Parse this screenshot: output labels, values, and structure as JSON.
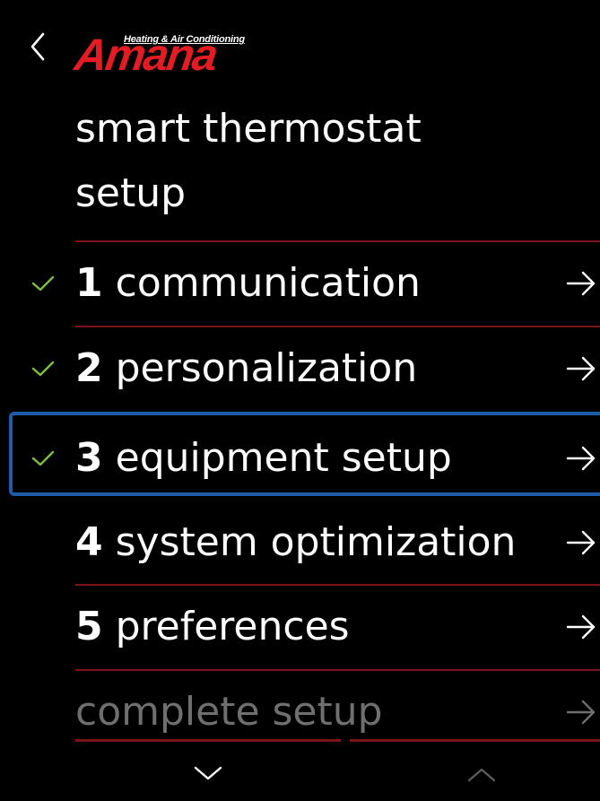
{
  "header": {
    "back_label": "",
    "logo": {
      "brand": "Amana",
      "tagline": "Heating & Air Conditioning"
    },
    "title_line1": "smart thermostat",
    "title_line2": "setup"
  },
  "steps": [
    {
      "number": "1",
      "label": "communication",
      "completed": true,
      "selected": false,
      "enabled": true
    },
    {
      "number": "2",
      "label": "personalization",
      "completed": true,
      "selected": false,
      "enabled": true
    },
    {
      "number": "3",
      "label": "equipment setup",
      "completed": true,
      "selected": true,
      "enabled": true
    },
    {
      "number": "4",
      "label": "system optimization",
      "completed": false,
      "selected": false,
      "enabled": true
    },
    {
      "number": "5",
      "label": "preferences",
      "completed": false,
      "selected": false,
      "enabled": true
    },
    {
      "number": "",
      "label": "complete setup",
      "completed": false,
      "selected": false,
      "enabled": false
    }
  ],
  "colors": {
    "background": "#000000",
    "text": "#ffffff",
    "divider": "#7a1418",
    "check": "#7fbf3f",
    "focus": "#1f5ba8",
    "disabled_text": "#6f6f6f",
    "brand_red": "#e31b23"
  },
  "icons": {
    "back": "chevron-left-icon",
    "check": "checkmark-icon",
    "arrow": "arrow-right-icon",
    "scroll_down": "chevron-down-icon",
    "scroll_up": "chevron-up-icon"
  }
}
